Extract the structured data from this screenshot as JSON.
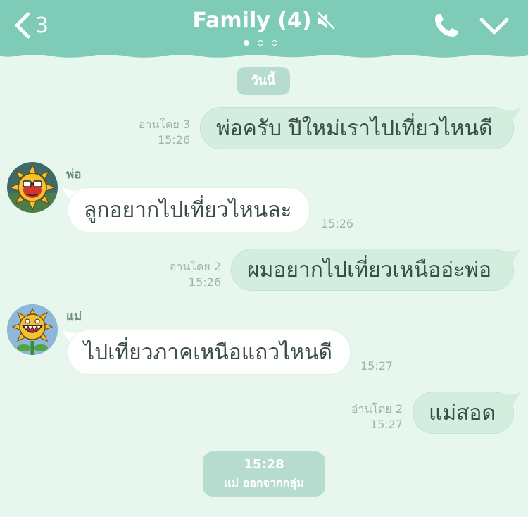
{
  "header": {
    "back_count": "3",
    "title": "Family (4)",
    "page_dots": 3,
    "active_dot": 0
  },
  "date_label": "วันนี้",
  "messages": [
    {
      "side": "mine",
      "text": "พ่อครับ ปีใหม่เราไปเที่ยวไหนดี",
      "read": "อ่านโดย 3",
      "time": "15:26"
    },
    {
      "side": "theirs",
      "sender": "พ่อ",
      "text": "ลูกอยากไปเที่ยวไหนละ",
      "time": "15:26"
    },
    {
      "side": "mine",
      "text": "ผมอยากไปเที่ยวเหนืออ่ะพ่อ",
      "read": "อ่านโดย 2",
      "time": "15:26"
    },
    {
      "side": "theirs",
      "sender": "แม่",
      "text": "ไปเที่ยวภาคเหนือแถวไหนดี",
      "time": "15:27"
    },
    {
      "side": "mine",
      "text": "แม่สอด",
      "read": "อ่านโดย 2",
      "time": "15:27"
    }
  ],
  "system": {
    "time": "15:28",
    "text": "แม่ ออกจากกลุ่ม"
  },
  "colors": {
    "header": "#7ecbb8",
    "background": "#e8f7ee",
    "mine_bubble": "#d3eedf",
    "theirs_bubble": "#ffffff",
    "badge": "#b5dccf"
  },
  "icons": [
    "back-chevron-icon",
    "mute-icon",
    "phone-icon",
    "chevron-down-icon"
  ]
}
